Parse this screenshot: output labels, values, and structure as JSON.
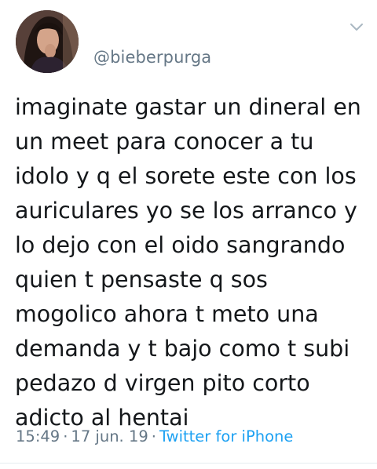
{
  "user": {
    "handle": "@bieberpurga",
    "avatar_icon": "profile-avatar"
  },
  "menu": {
    "icon": "chevron-down-icon"
  },
  "tweet": {
    "lines": [
      "imaginate gastar un dineral en",
      "un meet para conocer a tu",
      "idolo y q el sorete este con los",
      "auriculares yo se los arranco y",
      "lo dejo con el oido sangrando",
      "quien t pensaste q sos",
      "mogolico ahora t meto una",
      "demanda y t bajo como t subi",
      "pedazo d virgen pito corto",
      "adicto al hentai"
    ]
  },
  "meta": {
    "time": "15:49",
    "date": "17 jun. 19",
    "separator": "·",
    "source": "Twitter for iPhone"
  },
  "colors": {
    "text": "#14171a",
    "secondary": "#657786",
    "link": "#1da1f2"
  }
}
